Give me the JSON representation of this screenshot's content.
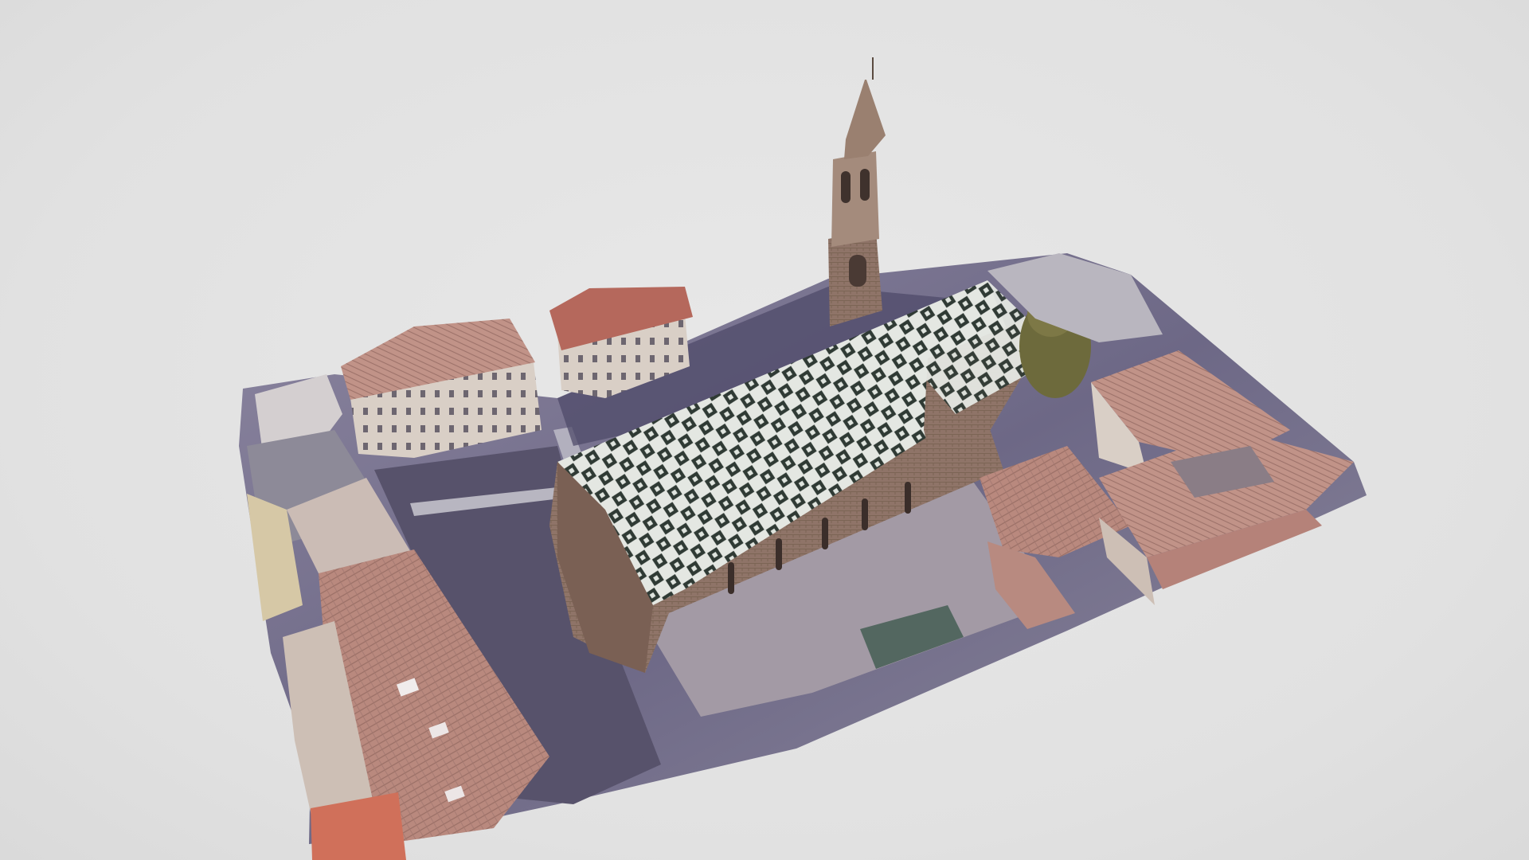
{
  "viewer": {
    "background_color": "#e3e3e3"
  },
  "model": {
    "colors": {
      "ground": "#6f6a86",
      "square": "#a59ba6",
      "street": "#57526b",
      "roof_tile": "#b9897e",
      "roof_tile_dark": "#8c6661",
      "roof_light": "#c9aaa2",
      "facade": "#d9cfc6",
      "facade_shadow": "#a99c97",
      "stone": "#8f7468",
      "stone_dark": "#6e564c",
      "roof_diamond_a": "#2f3a34",
      "roof_diamond_b": "#e4e7e2",
      "tree": "#6d6a3c",
      "orange_roof": "#d0705a"
    }
  }
}
